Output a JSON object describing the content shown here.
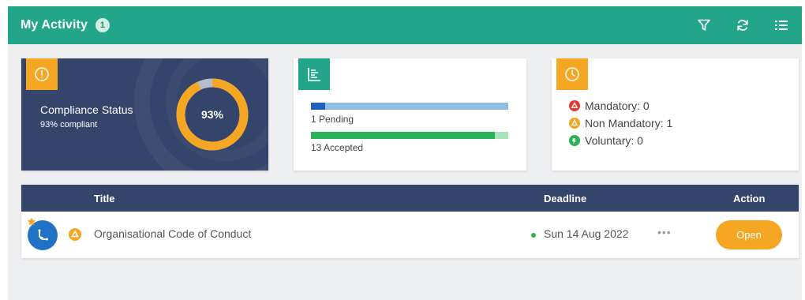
{
  "header": {
    "title": "My Activity",
    "count": "1",
    "icons": [
      "filter-icon",
      "refresh-icon",
      "list-view-icon"
    ]
  },
  "compliance": {
    "title": "Compliance Status",
    "subtitle": "93% compliant",
    "percent_label": "93%",
    "percent": 93,
    "colors": {
      "card": "#34446a",
      "ring": "#f5a623",
      "remainder": "#b5bcca",
      "tag": "#f5a623"
    }
  },
  "progress": {
    "pending": {
      "label": "1 Pending",
      "fraction": 0.07,
      "fill": "#1f5fbf",
      "track": "#8fbde6"
    },
    "accepted": {
      "label": "13 Accepted",
      "fraction": 0.93,
      "fill": "#2bb35a",
      "track": "#a7e3bb"
    }
  },
  "legend": {
    "mandatory": "Mandatory: 0",
    "non_mandatory": "Non Mandatory: 1",
    "voluntary": "Voluntary: 0",
    "colors": {
      "mandatory": "#e53935",
      "non_mandatory": "#f5a623",
      "voluntary": "#2bb35a"
    }
  },
  "table": {
    "columns": {
      "title": "Title",
      "deadline": "Deadline",
      "action": "Action"
    },
    "rows": [
      {
        "title": "Organisational Code of Conduct",
        "deadline": "Sun 14 Aug 2022",
        "more": "•••",
        "action": "Open",
        "type": "non-mandatory",
        "starred": true
      }
    ]
  },
  "theme": {
    "header": "#23a58a",
    "navy": "#34446a",
    "accent": "#f5a623"
  }
}
